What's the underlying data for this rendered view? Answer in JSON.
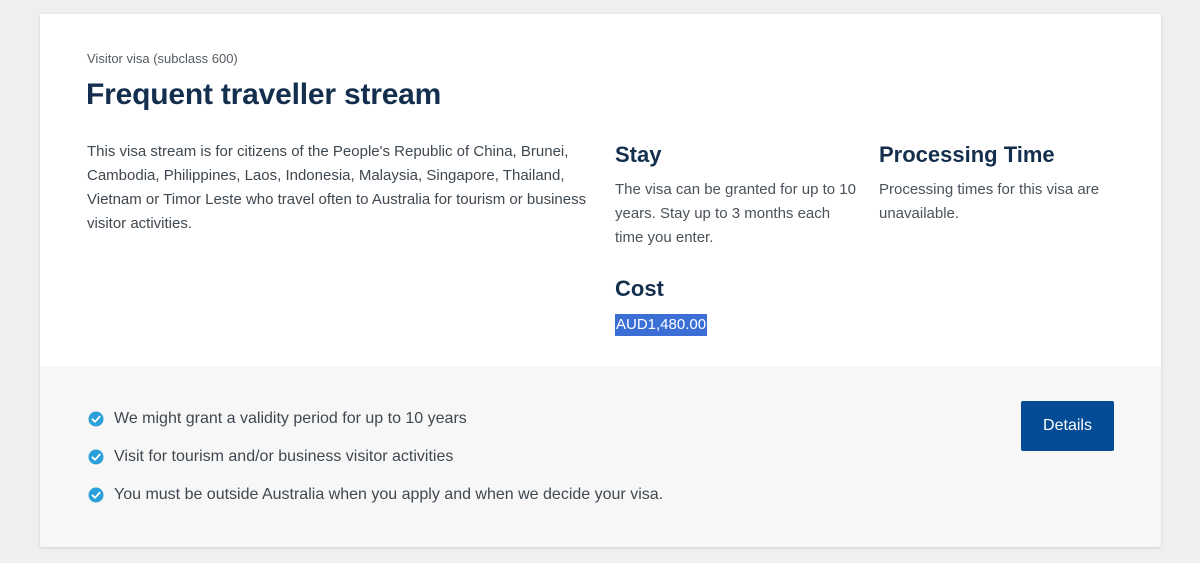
{
  "card": {
    "subtitle": "Visitor visa (subclass 600)",
    "title": "Frequent traveller stream",
    "description": "This visa stream is for citizens of the People's Republic of China, Brunei, Cambodia, Philippines, Laos, Indonesia, Malaysia, Singapore, Thailand, Vietnam or Timor Leste who travel often to Australia for tourism or business visitor activities."
  },
  "stay": {
    "heading": "Stay",
    "text": "The visa can be granted for up to 10 years. Stay up to 3 months each time you enter."
  },
  "processing": {
    "heading": "Processing Time",
    "text": "Processing times for this visa are unavailable."
  },
  "cost": {
    "heading": "Cost",
    "value": "AUD1,480.00"
  },
  "features": [
    "We might grant a validity period for up to 10 years",
    "Visit for tourism and/or business visitor activities",
    "You must be outside Australia when you apply and when we decide your visa."
  ],
  "details_button": {
    "label": "Details"
  },
  "colors": {
    "title": "#142f4e",
    "button": "#034b94",
    "check": "#2a9fd8",
    "selection": "#3b6fd6"
  },
  "icons": {
    "feature": "check-circle-icon"
  }
}
